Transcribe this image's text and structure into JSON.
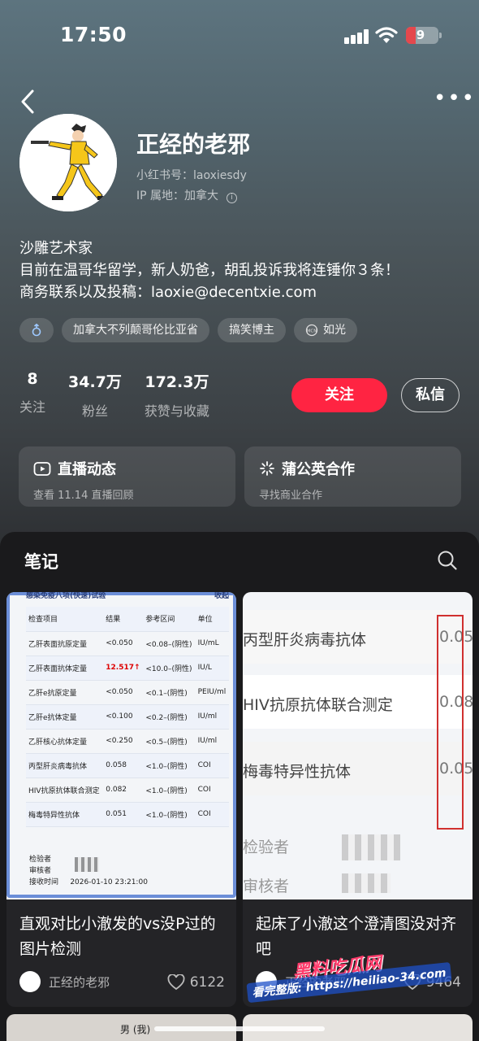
{
  "status_bar": {
    "time": "17:50",
    "battery": "9"
  },
  "profile": {
    "name": "正经的老邪",
    "red_id": "小红书号：laoxiesdy",
    "ip": "IP 属地：加拿大",
    "bio_lines": [
      "沙雕艺术家",
      "目前在温哥华留学，新人奶爸，胡乱投诉我将连锤你３条！",
      "商务联系以及投稿：laoxie@decentxie.com"
    ],
    "tags": [
      {
        "icon": "male-icon",
        "label": ""
      },
      {
        "icon": "",
        "label": "加拿大不列颠哥伦比亚省"
      },
      {
        "icon": "",
        "label": "搞笑博主"
      },
      {
        "icon": "mcn-icon",
        "label": "如光"
      }
    ],
    "stats": [
      {
        "num": "8",
        "label": "关注"
      },
      {
        "num": "34.7万",
        "label": "粉丝"
      },
      {
        "num": "172.3万",
        "label": "获赞与收藏"
      }
    ],
    "follow_label": "关注",
    "message_label": "私信"
  },
  "cards": [
    {
      "icon": "live-icon",
      "title": "直播动态",
      "subtitle": "查看 11.14 直播回顾"
    },
    {
      "icon": "dandelion-icon",
      "title": "蒲公英合作",
      "subtitle": "寻找商业合作"
    }
  ],
  "notes": {
    "title": "笔记",
    "posts": [
      {
        "title": "直观对比小澈发的vs没P过的图片检测",
        "author": "正经的老邪",
        "likes": "6122",
        "image": {
          "header": "感染免疫八项(快速)试验",
          "collapse": "收起",
          "columns": [
            "检查项目",
            "结果",
            "参考区间",
            "单位"
          ],
          "rows": [
            [
              "乙肝表面抗原定量",
              "<0.050",
              "<0.08–(阴性)",
              "IU/mL"
            ],
            [
              "乙肝表面抗体定量",
              "12.517↑",
              "<10.0–(阴性)",
              "IU/L"
            ],
            [
              "乙肝e抗原定量",
              "<0.050",
              "<0.1–(阴性)",
              "PEIU/ml"
            ],
            [
              "乙肝e抗体定量",
              "<0.100",
              "<0.2–(阴性)",
              "IU/ml"
            ],
            [
              "乙肝核心抗体定量",
              "<0.250",
              "<0.5–(阴性)",
              "IU/ml"
            ],
            [
              "丙型肝炎病毒抗体",
              "0.058",
              "<1.0–(阴性)",
              "COI"
            ],
            [
              "HIV抗原抗体联合测定",
              "0.082",
              "<1.0–(阴性)",
              "COI"
            ],
            [
              "梅毒特异性抗体",
              "0.051",
              "<1.0–(阴性)",
              "COI"
            ]
          ],
          "footer": [
            "检验者",
            "审核者",
            "接收时间",
            "2026-01-10 23:21:00"
          ]
        }
      },
      {
        "title": "起床了小澈这个澄清图没对齐吧",
        "author": "正经的老邪",
        "likes": "9464",
        "image": {
          "rows": [
            {
              "label": "丙型肝炎病毒抗体",
              "value": "0.05"
            },
            {
              "label": "HIV抗原抗体联合测定",
              "value": "0.08"
            },
            {
              "label": "梅毒特异性抗体",
              "value": "0.05"
            }
          ],
          "footer": [
            "检验者",
            "审核者"
          ]
        }
      }
    ],
    "next_row_text": "男 (我)"
  },
  "watermark": {
    "line1": "黑料吃瓜网",
    "line2": "看完整版: https://heiliao-34.com"
  },
  "colors": {
    "accent": "#ff2442"
  }
}
